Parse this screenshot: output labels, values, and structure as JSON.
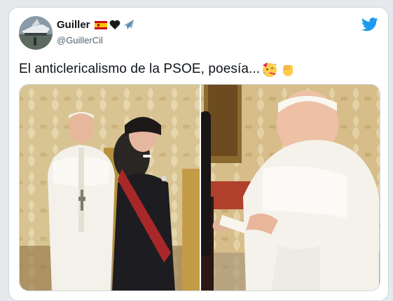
{
  "tweet": {
    "author": {
      "name": "Guiller",
      "handle": "@GuillerCil",
      "name_emojis": [
        "spain-flag-icon",
        "black-heart-icon",
        "airplane-icon"
      ]
    },
    "text": "El anticlericalismo de la PSOE, poesía...",
    "text_emojis": [
      "party-face-icon",
      "raised-fist-icon"
    ],
    "media": [
      {
        "description": "Pope and woman in black mantilla standing in front of golden damask wall"
      },
      {
        "description": "Pope receiving an envelope from a woman"
      }
    ]
  },
  "colors": {
    "accent": "#1d9bf0",
    "text": "#0f1419",
    "secondary": "#536471",
    "wallpaper": "#d8c392"
  }
}
